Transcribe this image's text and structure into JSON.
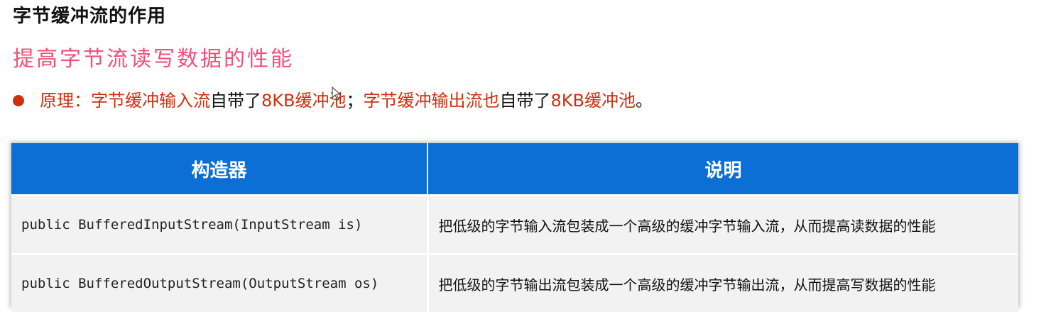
{
  "heading": "字节缓冲流的作用",
  "subheading": "提高字节流读写数据的性能",
  "colors": {
    "accent_red": "#d12e0f",
    "pink": "#f0507a",
    "table_header": "#0b6fd6"
  },
  "principle": {
    "label": "原理：",
    "part1_red": "字节缓冲输入流",
    "part2": "自带了",
    "part3_red": "8KB缓冲池",
    "part4": "；",
    "part5_red": "字节缓冲输出流也",
    "part6": "自带了",
    "part7_red": "8KB缓冲池",
    "part8": "。"
  },
  "table": {
    "headers": [
      "构造器",
      "说明"
    ],
    "rows": [
      {
        "constructor": "public BufferedInputStream(InputStream is)",
        "description": "把低级的字节输入流包装成一个高级的缓冲字节输入流，从而提高读数据的性能"
      },
      {
        "constructor": "public BufferedOutputStream(OutputStream os)",
        "description": "把低级的字节输出流包装成一个高级的缓冲字节输出流，从而提高写数据的性能"
      }
    ]
  }
}
